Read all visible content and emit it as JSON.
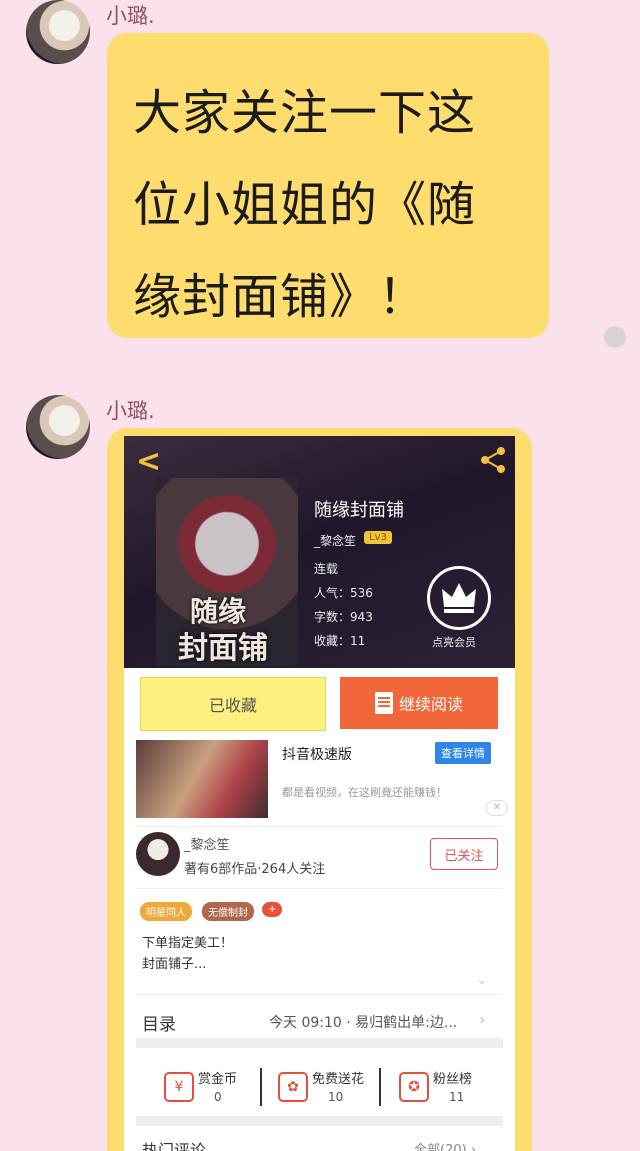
{
  "messages": [
    {
      "sender": "小璐.",
      "text": "大家关注一下这位小姐姐的《随缘封面铺》！"
    },
    {
      "sender": "小璐."
    }
  ],
  "shared_page": {
    "cover_text": [
      "随缘",
      "封面铺"
    ],
    "book_title": "随缘封面铺",
    "author": "_黎念笙",
    "level": "Lv3",
    "status": "连载",
    "popularity": "人气：536",
    "word_count": "字数：943",
    "favorites": "收藏：11",
    "vip_label": "点亮会员",
    "btn_favorited": "已收藏",
    "btn_continue": "继续阅读",
    "ad": {
      "title": "抖音极速版",
      "button": "查看详情",
      "desc": "都是看视频，在这刷竟还能赚钱！",
      "close": "✕"
    },
    "author_card": {
      "name": "_黎念笙",
      "stats": "著有6部作品·264人关注",
      "follow": "已关注"
    },
    "tags": [
      {
        "label": "明星同人",
        "color": "#f0a83a"
      },
      {
        "label": "无偿制封",
        "color": "#b0674b"
      },
      {
        "label": "+",
        "color": "#e8503a"
      }
    ],
    "intro": [
      "下单指定美工！",
      "封面铺子..."
    ],
    "toc": {
      "label": "目录",
      "latest": "今天 09:10 · 易归鹤出单:边..."
    },
    "actions": [
      {
        "label": "赏金币",
        "value": "0",
        "icon": "coin-icon"
      },
      {
        "label": "免费送花",
        "value": "10",
        "icon": "flower-icon"
      },
      {
        "label": "粉丝榜",
        "value": "11",
        "icon": "medal-icon"
      }
    ],
    "hot_comments": "热门评论",
    "all_comments": "全部(20) ›"
  },
  "colors": {
    "background": "#fbe1ec",
    "bubble": "#fedd6e",
    "accent": "#f2673a"
  }
}
